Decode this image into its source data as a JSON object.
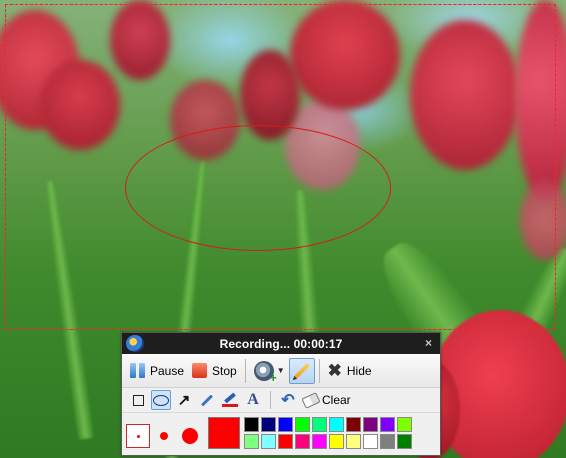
{
  "recorder": {
    "title": "Recording... 00:00:17",
    "close_glyph": "×",
    "toolbar": {
      "pause_label": "Pause",
      "stop_label": "Stop",
      "hide_label": "Hide",
      "dropdown_glyph": "▼"
    },
    "draw_tools": {
      "arrow_glyph": "↗",
      "text_glyph": "A",
      "undo_glyph": "↶",
      "clear_label": "Clear",
      "selected_tool": "ellipse"
    },
    "brush": {
      "current_color": "#ff0000",
      "selected_size": "small"
    },
    "palette": [
      "#000000",
      "#00007f",
      "#0000ff",
      "#00ff00",
      "#00ff7f",
      "#00ffff",
      "#7f0000",
      "#7f007f",
      "#7f00ff",
      "#7fff00",
      "#7fff7f",
      "#7fffff",
      "#ff0000",
      "#ff007f",
      "#ff00ff",
      "#ffff00",
      "#ffff7f",
      "#ffffff",
      "#7f7f7f",
      "#007f00"
    ],
    "icons": {
      "logo": "recorder-logo-icon",
      "pause": "pause-icon",
      "stop": "stop-icon",
      "camera": "webcam-icon",
      "pen": "pen-icon",
      "hide": "close-x-icon"
    }
  },
  "overlay": {
    "selection_color": "#e02020",
    "ellipse_color": "#d81a1a"
  }
}
